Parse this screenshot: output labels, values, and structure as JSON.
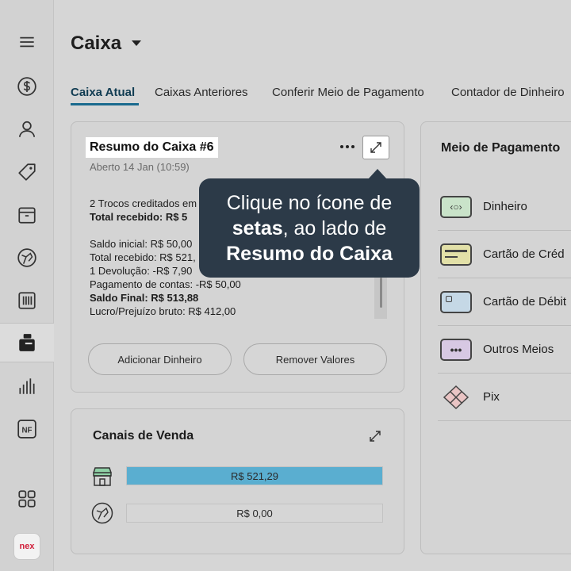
{
  "header": {
    "title": "Caixa"
  },
  "tabs": [
    {
      "label": "Caixa Atual"
    },
    {
      "label": "Caixas Anteriores"
    },
    {
      "label": "Conferir Meio de Pagamento"
    },
    {
      "label": "Contador de Dinheiro"
    }
  ],
  "summary": {
    "title": "Resumo do Caixa #6",
    "subtitle": "Aberto 14 Jan (10:59)",
    "trocos": "2 Trocos creditados em",
    "total_recebido_bold": "Total recebido: R$ 5",
    "lines": [
      "Saldo inicial: R$ 50,00",
      "Total recebido: R$ 521,",
      "1 Devolução: -R$ 7,90",
      "Pagamento de contas: -R$ 50,00"
    ],
    "saldo_final": "Saldo Final: R$ 513,88",
    "lucro": "Lucro/Prejuízo bruto: R$ 412,00",
    "add_button": "Adicionar Dinheiro",
    "remove_button": "Remover Valores"
  },
  "tooltip": {
    "line1": "Clique no ícone de",
    "line2_bold": "setas",
    "line2_rest": ", ao lado de",
    "line3_bold": "Resumo do Caixa"
  },
  "canais": {
    "title": "Canais de Venda",
    "bars": [
      {
        "icon": "store-icon",
        "value_label": "R$ 521,29",
        "fill_fraction": 1.0,
        "color": "#5aaed0"
      },
      {
        "icon": "ifood-icon",
        "value_label": "R$ 0,00",
        "fill_fraction": 0.0,
        "color": "#5aaed0"
      }
    ]
  },
  "meio": {
    "title": "Meio de Pagamento",
    "items": [
      {
        "label": "Dinheiro",
        "icon": "cash-icon",
        "color": "#c9e3c9"
      },
      {
        "label": "Cartão de Créd",
        "icon": "credit-card-icon",
        "color": "#e2e0a8"
      },
      {
        "label": "Cartão de Débit",
        "icon": "debit-card-icon",
        "color": "#c5d8e6"
      },
      {
        "label": "Outros Meios",
        "icon": "other-methods-icon",
        "color": "#d7c8e3"
      },
      {
        "label": "Pix",
        "icon": "pix-icon",
        "color": "#e9c4c4"
      }
    ]
  },
  "sidebar": {
    "logo": "nex"
  }
}
